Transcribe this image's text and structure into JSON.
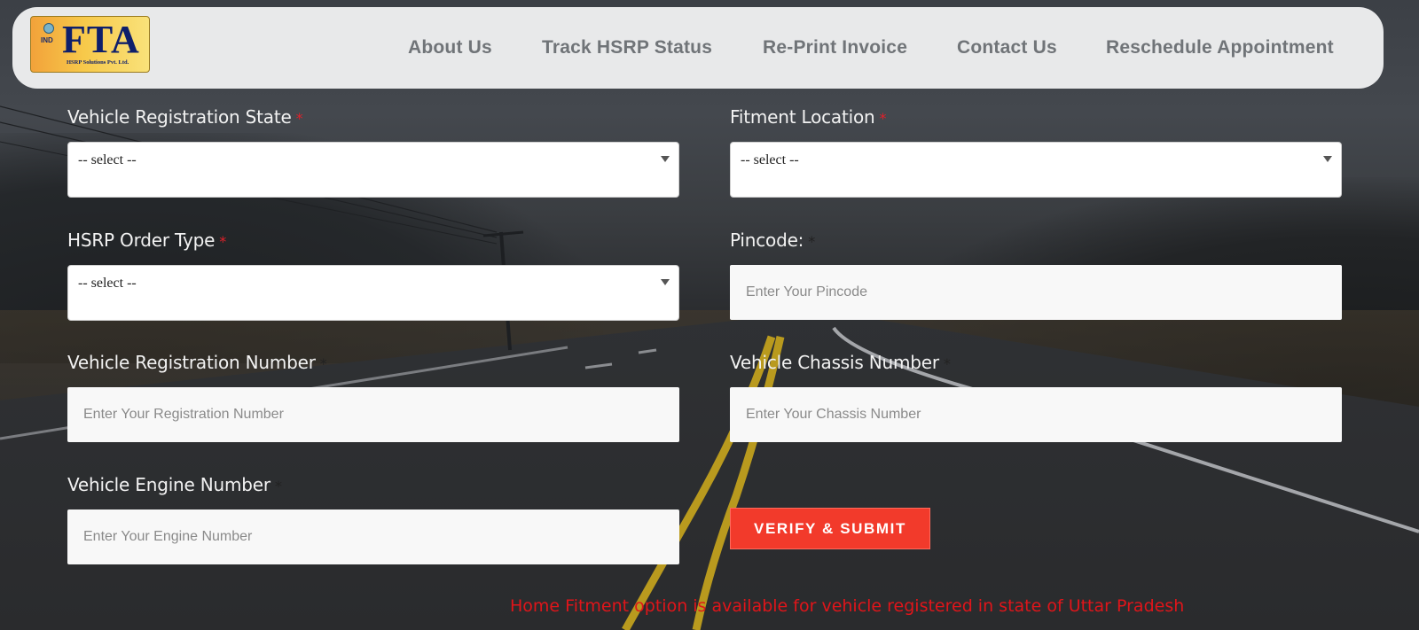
{
  "header": {
    "logo": {
      "emblem_text": "IND",
      "brand": "FTA",
      "tagline": "HSRP Solutions Pvt. Ltd."
    },
    "nav": [
      {
        "label": "About Us"
      },
      {
        "label": "Track HSRP Status"
      },
      {
        "label": "Re-Print Invoice"
      },
      {
        "label": "Contact Us"
      },
      {
        "label": "Reschedule Appointment"
      }
    ]
  },
  "form": {
    "registration_state": {
      "label": "Vehicle Registration State",
      "required_mark": "*",
      "selected": "-- select --"
    },
    "fitment_location": {
      "label": "Fitment Location",
      "required_mark": "*",
      "selected": "-- select --"
    },
    "order_type": {
      "label": "HSRP Order Type",
      "required_mark": "*",
      "selected": "-- select --"
    },
    "pincode": {
      "label": "Pincode:",
      "required_mark": "*",
      "placeholder": "Enter Your Pincode",
      "value": ""
    },
    "registration_number": {
      "label": "Vehicle Registration Number",
      "required_mark": "*",
      "placeholder": "Enter Your Registration Number",
      "value": ""
    },
    "chassis_number": {
      "label": "Vehicle Chassis Number",
      "required_mark": "*",
      "placeholder": "Enter Your Chassis Number",
      "value": ""
    },
    "engine_number": {
      "label": "Vehicle Engine Number",
      "required_mark": "*",
      "placeholder": "Enter Your Engine Number",
      "value": ""
    },
    "submit_label": "VERIFY & SUBMIT"
  },
  "notice": "Home Fitment option is available for vehicle registered in state of Uttar Pradesh",
  "colors": {
    "accent_button": "#f23a2b",
    "required_mark": "#e0202a",
    "notice_text": "#e0151a",
    "header_bg": "#e8e9ea",
    "nav_text": "#707478"
  }
}
